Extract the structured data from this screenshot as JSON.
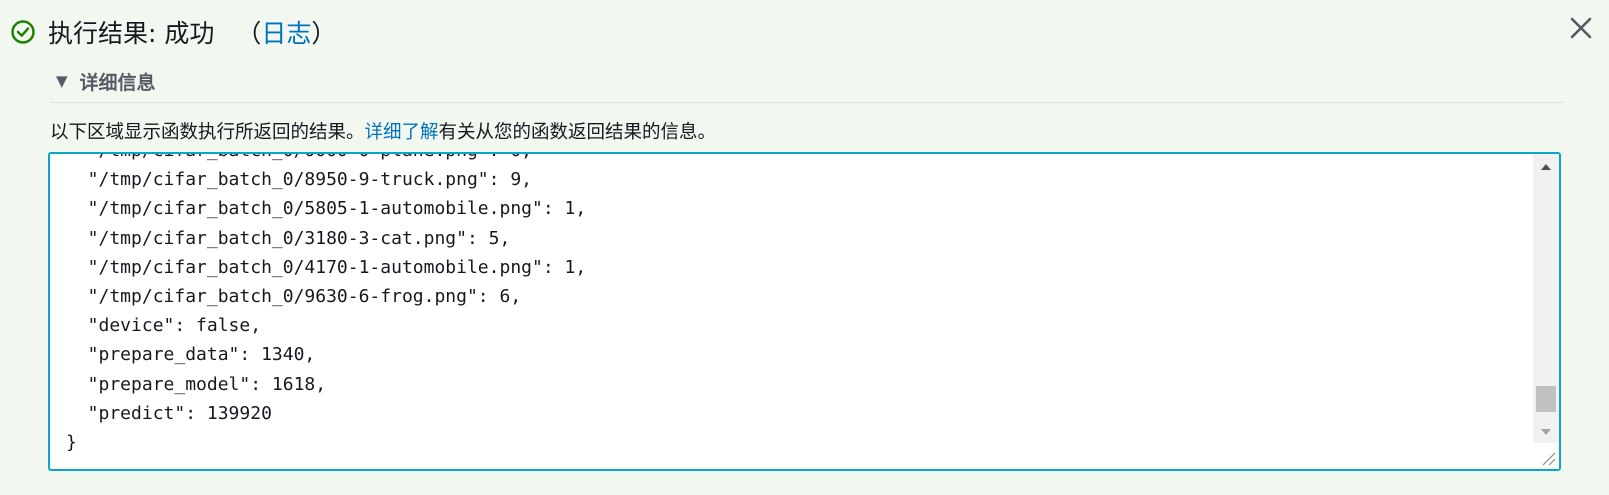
{
  "header": {
    "title": "执行结果: 成功",
    "paren_open": "（",
    "log_link": "日志",
    "paren_close": "）"
  },
  "details": {
    "label": "详细信息",
    "expanded": true
  },
  "description": {
    "text_before": "以下区域显示函数执行所返回的结果。",
    "link": "详细了解",
    "text_after": "有关从您的函数返回结果的信息。"
  },
  "output_lines": [
    "  \"/tmp/cifar_batch_0/8950-9-truck.png\": 9,",
    "  \"/tmp/cifar_batch_0/5805-1-automobile.png\": 1,",
    "  \"/tmp/cifar_batch_0/3180-3-cat.png\": 5,",
    "  \"/tmp/cifar_batch_0/4170-1-automobile.png\": 1,",
    "  \"/tmp/cifar_batch_0/9630-6-frog.png\": 6,",
    "  \"device\": false,",
    "  \"prepare_data\": 1340,",
    "  \"prepare_model\": 1618,",
    "  \"predict\": 139920",
    "}"
  ],
  "icons": {
    "status": "check-circle-icon",
    "close": "close-icon",
    "caret": "caret-down-icon"
  },
  "colors": {
    "success": "#1d8102",
    "link": "#0073bb",
    "focus_border": "#0aa7ca",
    "panel_bg": "#f2f8f0"
  }
}
